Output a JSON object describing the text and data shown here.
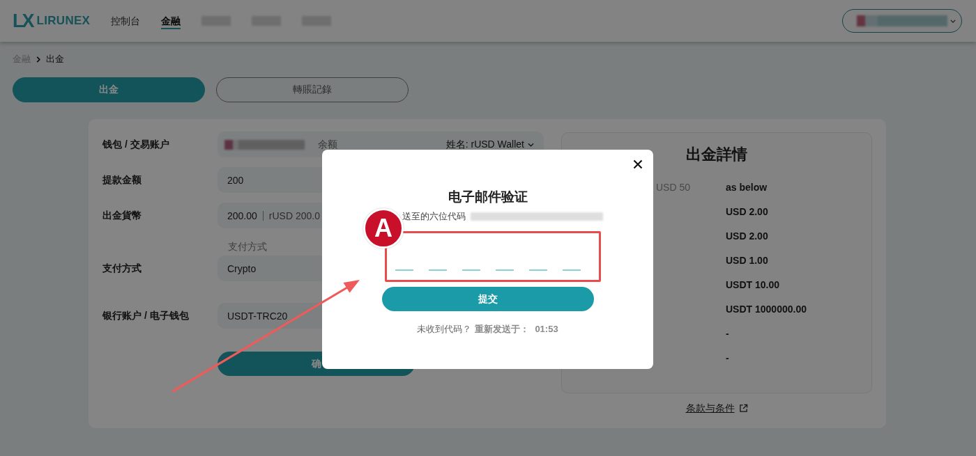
{
  "header": {
    "logo": {
      "mark": "LX",
      "name": "LIRUNEX"
    },
    "nav": [
      {
        "kind": "link",
        "label": "控制台",
        "selected": false
      },
      {
        "kind": "link",
        "label": "金融",
        "selected": true
      },
      {
        "kind": "redacted",
        "selected": false
      },
      {
        "kind": "redacted",
        "selected": false
      },
      {
        "kind": "redacted",
        "selected": false
      }
    ]
  },
  "breadcrumb": [
    {
      "label": "金融",
      "current": false
    },
    {
      "label": "出金",
      "current": true
    }
  ],
  "tabs": [
    {
      "label": "出金",
      "selected": true
    },
    {
      "label": "轉賬記錄",
      "selected": false
    }
  ],
  "form": {
    "rows": [
      {
        "kind": "account",
        "label": "钱包 / 交易账户",
        "balance_label": "余额",
        "name_select": "姓名: rUSD Wallet"
      },
      {
        "kind": "text",
        "label": "提款金额",
        "value": "200"
      },
      {
        "kind": "currency",
        "label": "出金貨幣",
        "value": "200.00",
        "converted": "rUSD 200.0"
      },
      {
        "kind": "select",
        "label": "支付方式",
        "floating_label": "支付方式",
        "value": "Crypto"
      },
      {
        "kind": "text",
        "label": "银行账户 / 电子钱包",
        "value": "USDT-TRC20"
      }
    ],
    "confirm_button": "确"
  },
  "details": {
    "title": "出金詳情",
    "rows": [
      {
        "label": "USD 50",
        "value": "as below"
      },
      {
        "value": "USD 2.00"
      },
      {
        "value": "USD 2.00"
      },
      {
        "value": "USD 1.00"
      },
      {
        "value": "USDT 10.00"
      },
      {
        "value": "USDT 1000000.00"
      },
      {
        "value": "-"
      },
      {
        "value": "-"
      }
    ],
    "terms_link": "条款与条件"
  },
  "modal": {
    "title": "电子邮件验证",
    "subtitle": "送至的六位代码",
    "code_fields": [
      {
        "filled": false
      },
      {
        "filled": false
      },
      {
        "filled": false
      },
      {
        "filled": false
      },
      {
        "filled": false
      },
      {
        "filled": false
      }
    ],
    "submit_button": "提交",
    "resend_prompt": "未收到代码？",
    "resend_label": "重新发送于：",
    "countdown": "01:53"
  },
  "annotation": {
    "badge": "A"
  }
}
